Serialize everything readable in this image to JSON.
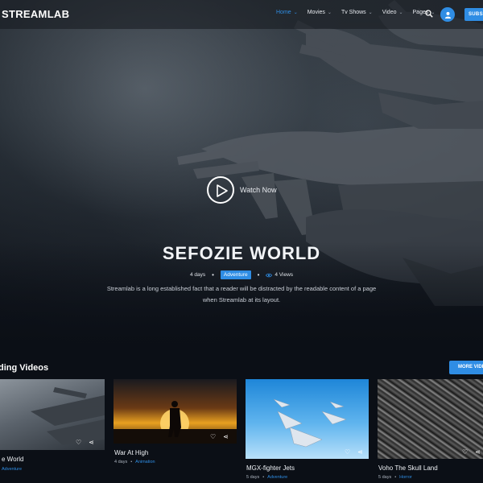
{
  "header": {
    "logo": "STREAMLAB",
    "nav": [
      {
        "label": "Home",
        "active": true
      },
      {
        "label": "Movies",
        "active": false
      },
      {
        "label": "Tv Shows",
        "active": false
      },
      {
        "label": "Video",
        "active": false
      },
      {
        "label": "Pages",
        "active": false
      }
    ],
    "icons": {
      "search": "search-icon",
      "user": "user-icon"
    },
    "subscribe_label": "SUBSC"
  },
  "hero": {
    "watch_label": "Watch Now",
    "title": "SEFOZIE WORLD",
    "age": "4 days",
    "genre": "Adventure",
    "views": "4 Views",
    "description": "Streamlab is a long established fact that a reader will be distracted by the readable content of a page when Streamlab at its layout."
  },
  "section": {
    "title": "ding Videos",
    "more_label": "MORE VIDE"
  },
  "cards": [
    {
      "title": "e World",
      "age": "",
      "genre": "Adventure"
    },
    {
      "title": "War At High",
      "age": "4 days",
      "genre": "Animation"
    },
    {
      "title": "MGX-fighter Jets",
      "age": "5 days",
      "genre": "Adventure"
    },
    {
      "title": "Voho The Skull Land",
      "age": "5 days",
      "genre": "Horror"
    }
  ],
  "colors": {
    "accent": "#2f8de4",
    "background": "#0b0f16"
  }
}
